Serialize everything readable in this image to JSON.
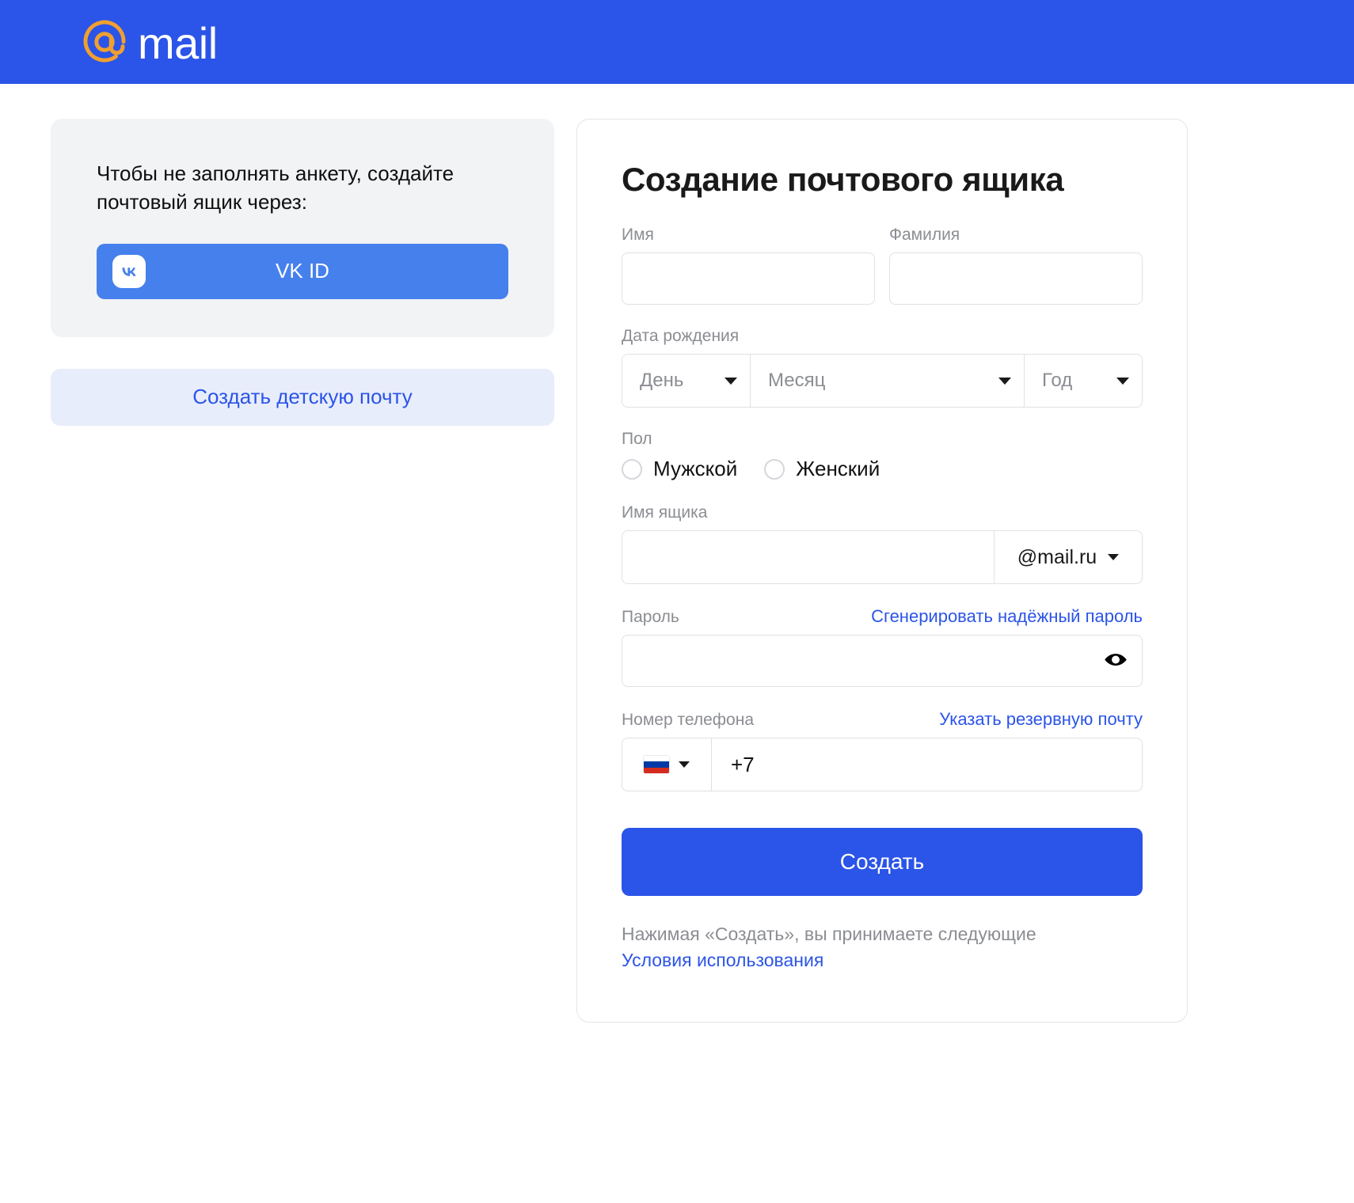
{
  "header": {
    "logo_at_icon": "at-sign-icon",
    "logo_text": "mail",
    "background_color": "#2b54e8"
  },
  "left_panel": {
    "social_card": {
      "prompt_text": "Чтобы не заполнять анкету, создайте почтовый ящик через:",
      "vk_button": {
        "label": "VK ID",
        "icon": "vk-logo-icon",
        "color": "#4680ec"
      }
    },
    "kid_mail_button": {
      "label": "Создать детскую почту",
      "color": "#2b54e8",
      "background": "#e8edfb"
    }
  },
  "form": {
    "title": "Создание почтового ящика",
    "first_name": {
      "label": "Имя",
      "value": "",
      "placeholder": ""
    },
    "last_name": {
      "label": "Фамилия",
      "value": "",
      "placeholder": ""
    },
    "birth_date": {
      "label": "Дата рождения",
      "day": {
        "selected": "День",
        "options": [
          "День"
        ]
      },
      "month": {
        "selected": "Месяц",
        "options": [
          "Месяц"
        ]
      },
      "year": {
        "selected": "Год",
        "options": [
          "Год"
        ]
      }
    },
    "gender": {
      "label": "Пол",
      "options": [
        {
          "label": "Мужской",
          "selected": false
        },
        {
          "label": "Женский",
          "selected": false
        }
      ]
    },
    "mailbox": {
      "label": "Имя ящика",
      "value": "",
      "placeholder": "",
      "domain": {
        "selected": "@mail.ru",
        "options": [
          "@mail.ru"
        ]
      }
    },
    "password": {
      "label": "Пароль",
      "value": "",
      "placeholder": "",
      "generate_link": "Сгенерировать надёжный пароль",
      "toggle_icon": "eye-icon"
    },
    "phone": {
      "label": "Номер телефона",
      "backup_email_link": "Указать резервную почту",
      "country_flag": "russia-flag-icon",
      "value": "+7",
      "placeholder": ""
    },
    "submit": {
      "label": "Создать",
      "color": "#2b54e8"
    },
    "terms": {
      "text": "Нажимая «Создать», вы принимаете следующие",
      "link": "Условия использования"
    }
  }
}
